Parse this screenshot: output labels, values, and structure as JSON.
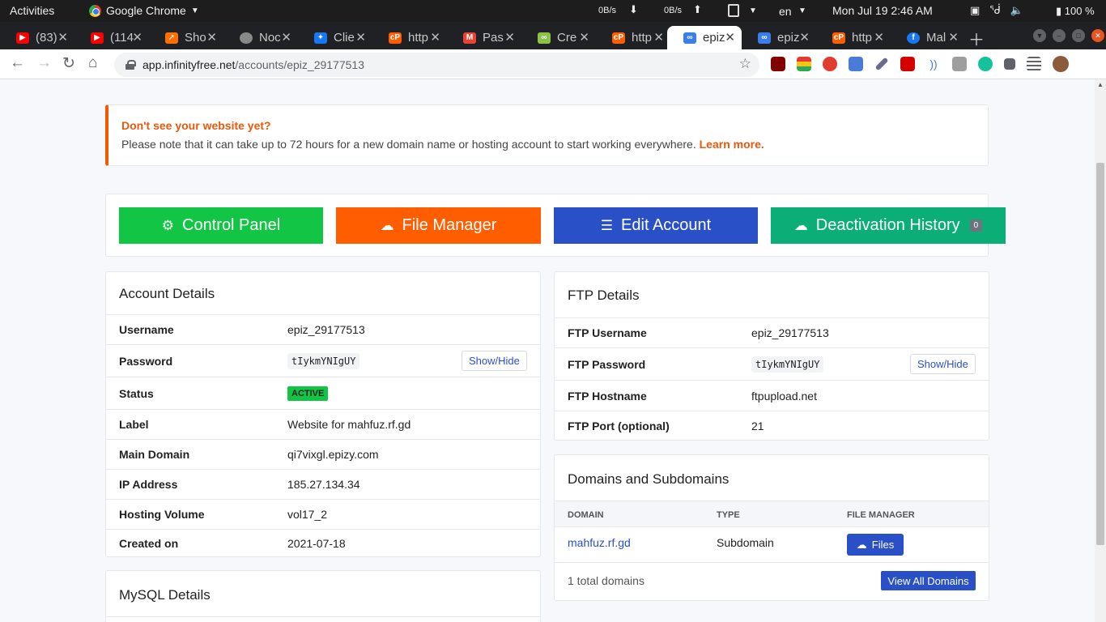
{
  "system": {
    "activities": "Activities",
    "app_name": "Google Chrome",
    "net_down": "0B/s",
    "net_up": "0B/s",
    "lang": "en",
    "clock": "Mon Jul 19  2:46 AM",
    "battery": "100 %"
  },
  "tabs": [
    {
      "label": "(83)",
      "color": "#ff0000",
      "icon": "youtube-icon"
    },
    {
      "label": "(114",
      "color": "#ff0000",
      "icon": "youtube-icon"
    },
    {
      "label": "Sho",
      "color": "#ff6f00",
      "icon": "rocket-icon"
    },
    {
      "label": "Noc",
      "color": "#888888",
      "icon": "globe-icon"
    },
    {
      "label": "Clie",
      "color": "#1877f2",
      "icon": "wand-icon"
    },
    {
      "label": "http",
      "color": "#ff5d00",
      "icon": "cpanel-icon"
    },
    {
      "label": "Pas",
      "color": "#ea4335",
      "icon": "gmail-icon"
    },
    {
      "label": "Cre",
      "color": "#8bc34a",
      "icon": "infinity-icon"
    },
    {
      "label": "http",
      "color": "#ff5d00",
      "icon": "cpanel-icon"
    },
    {
      "label": "epiz",
      "color": "#3b7de9",
      "icon": "infinity-icon"
    },
    {
      "label": "epiz",
      "color": "#3b7de9",
      "icon": "infinity-icon"
    },
    {
      "label": "http",
      "color": "#ff5d00",
      "icon": "cpanel-icon"
    },
    {
      "label": "Mal",
      "color": "#1877f2",
      "icon": "facebook-icon"
    }
  ],
  "address": {
    "host": "app.infinityfree.net",
    "path": "/accounts/epiz_29177513"
  },
  "notice": {
    "title": "Don't see your website yet?",
    "text": "Please note that it can take up to 72 hours for a new domain name or hosting account to start working everywhere.",
    "link": "Learn more."
  },
  "actions": {
    "control_panel": "Control Panel",
    "file_manager": "File Manager",
    "edit_account": "Edit Account",
    "deactivation_history": "Deactivation History",
    "deactivation_count": "0"
  },
  "account": {
    "title": "Account Details",
    "rows": [
      {
        "label": "Username",
        "value": "epiz_29177513"
      },
      {
        "label": "Password",
        "value": "tIykmYNIgUY"
      },
      {
        "label": "Status",
        "value": "ACTIVE"
      },
      {
        "label": "Label",
        "value": "Website for mahfuz.rf.gd"
      },
      {
        "label": "Main Domain",
        "value": "qi7vixgl.epizy.com"
      },
      {
        "label": "IP Address",
        "value": "185.27.134.34"
      },
      {
        "label": "Hosting Volume",
        "value": "vol17_2"
      },
      {
        "label": "Created on",
        "value": "2021-07-18"
      }
    ],
    "show_hide": "Show/Hide"
  },
  "ftp": {
    "title": "FTP Details",
    "rows": [
      {
        "label": "FTP Username",
        "value": "epiz_29177513"
      },
      {
        "label": "FTP Password",
        "value": "tIykmYNIgUY"
      },
      {
        "label": "FTP Hostname",
        "value": "ftpupload.net"
      },
      {
        "label": "FTP Port (optional)",
        "value": "21"
      }
    ],
    "show_hide": "Show/Hide"
  },
  "domains": {
    "title": "Domains and Subdomains",
    "columns": [
      "DOMAIN",
      "TYPE",
      "FILE MANAGER"
    ],
    "rows": [
      {
        "domain": "mahfuz.rf.gd",
        "type": "Subdomain",
        "action": "Files"
      }
    ],
    "total": "1 total domains",
    "view_all": "View All Domains"
  },
  "mysql": {
    "title": "MySQL Details"
  }
}
